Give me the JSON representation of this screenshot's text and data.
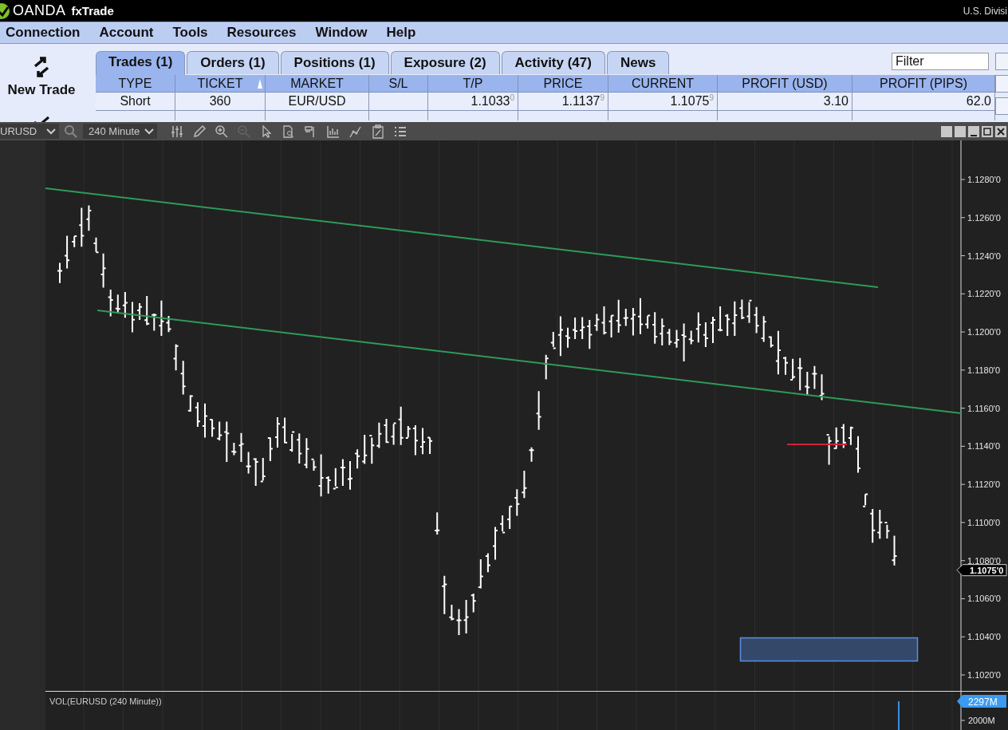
{
  "title_bar": {
    "brand": "OANDA",
    "product": "fxTrade",
    "division": "U.S. Divisi"
  },
  "menu": [
    "Connection",
    "Account",
    "Tools",
    "Resources",
    "Window",
    "Help"
  ],
  "new_trade": {
    "label": "New Trade"
  },
  "tabs": [
    {
      "label": "Trades (1)",
      "selected": true
    },
    {
      "label": "Orders (1)",
      "selected": false
    },
    {
      "label": "Positions (1)",
      "selected": false
    },
    {
      "label": "Exposure (2)",
      "selected": false
    },
    {
      "label": "Activity (47)",
      "selected": false
    },
    {
      "label": "News",
      "selected": false
    }
  ],
  "filter": {
    "placeholder": "Filter"
  },
  "table": {
    "columns": [
      {
        "label": "TYPE",
        "sorted": false
      },
      {
        "label": "TICKET",
        "sorted": true
      },
      {
        "label": "MARKET",
        "sorted": false
      },
      {
        "label": "S/L",
        "sorted": false
      },
      {
        "label": "T/P",
        "sorted": false
      },
      {
        "label": "PRICE",
        "sorted": false
      },
      {
        "label": "CURRENT",
        "sorted": false
      },
      {
        "label": "PROFIT (USD)",
        "sorted": false
      },
      {
        "label": "PROFIT (PIPS)",
        "sorted": false
      }
    ],
    "rows": [
      [
        "Short",
        "360",
        "EUR/USD",
        "",
        "1.1033$^{0}$",
        "1.1137$^{9}$",
        "1.1075$^{9}$",
        "3.10",
        "62.0"
      ]
    ]
  },
  "chart_toolbar": {
    "instrument": "URUSD",
    "timeframe": "240 Minute"
  },
  "chart": {
    "price_axis": [
      "1.1280'0",
      "1.1260'0",
      "1.1240'0",
      "1.1220'0",
      "1.1200'0",
      "1.1180'0",
      "1.1160'0",
      "1.1140'0",
      "1.1120'0",
      "1.1100'0",
      "1.1080'0",
      "1.1060'0",
      "1.1040'0",
      "1.1020'0"
    ],
    "current_price": "1.1075'0",
    "volume_pane": {
      "title": "VOL(EURUSD (240 Minute))",
      "current": "2297M",
      "axis": [
        "2000M"
      ]
    }
  }
}
